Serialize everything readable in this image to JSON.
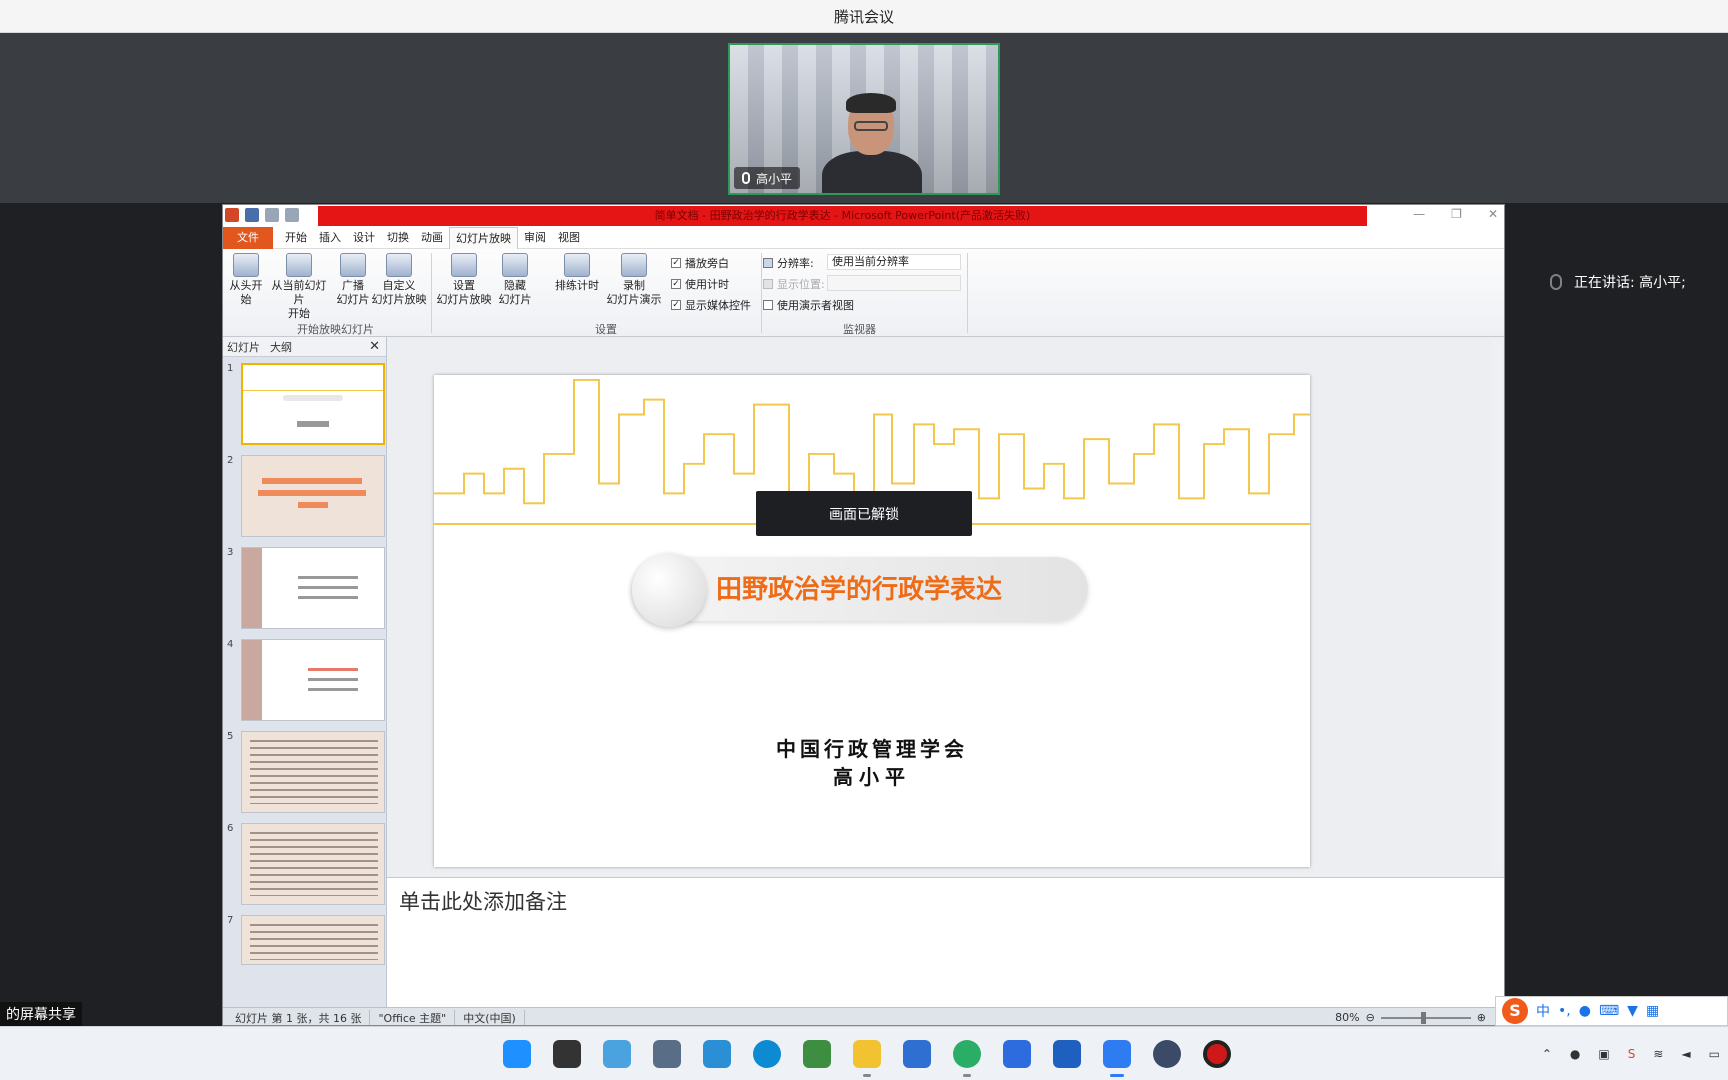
{
  "app": {
    "title": "腾讯会议"
  },
  "video": {
    "participant_name": "高小平"
  },
  "speaking": {
    "label": "正在讲话: 高小平;"
  },
  "ppt": {
    "window_title": "简单文档 - 田野政治学的行政学表达 - Microsoft PowerPoint(产品激活失败)",
    "tabs": [
      "文件",
      "开始",
      "插入",
      "设计",
      "切换",
      "动画",
      "幻灯片放映",
      "审阅",
      "视图"
    ],
    "active_tab": "幻灯片放映",
    "ribbon": {
      "from_start": "从头开始",
      "from_current_1": "从当前幻灯片",
      "from_current_2": "开始",
      "broadcast_1": "广播",
      "broadcast_2": "幻灯片",
      "custom_1": "自定义",
      "custom_2": "幻灯片放映",
      "group_start": "开始放映幻灯片",
      "setup_1": "设置",
      "setup_2": "幻灯片放映",
      "hide_1": "隐藏",
      "hide_2": "幻灯片",
      "rehearse": "排练计时",
      "record_1": "录制",
      "record_2": "幻灯片演示",
      "chk_narration": "播放旁白",
      "chk_timing": "使用计时",
      "chk_media": "显示媒体控件",
      "group_setup": "设置",
      "resolution_label": "分辨率:",
      "resolution_value": "使用当前分辨率",
      "show_on": "显示位置:",
      "presenter_view": "使用演示者视图",
      "group_monitor": "监视器"
    },
    "panel": {
      "tab_slides": "幻灯片",
      "tab_outline": "大纲",
      "close": "✕"
    },
    "thumbnails": [
      "1",
      "2",
      "3",
      "4",
      "5",
      "6",
      "7"
    ],
    "slide": {
      "title": "田野政治学的行政学表达",
      "org": "中国行政管理学会",
      "author": "高小平"
    },
    "notes_placeholder": "单击此处添加备注",
    "status": {
      "slide_info": "幻灯片 第 1 张，共 16 张",
      "theme": "\"Office 主题\"",
      "language": "中文(中国)",
      "zoom": "80%"
    }
  },
  "overlay": {
    "text": "画面已解锁"
  },
  "screenshare": {
    "label": "的屏幕共享"
  },
  "ime": {
    "zh": "中"
  },
  "colors": {
    "accent_red": "#e51515",
    "file_tab": "#e2571e",
    "title_orange": "#ee6b17",
    "skyline": "#f3c64c",
    "video_border": "#2f9a55"
  }
}
